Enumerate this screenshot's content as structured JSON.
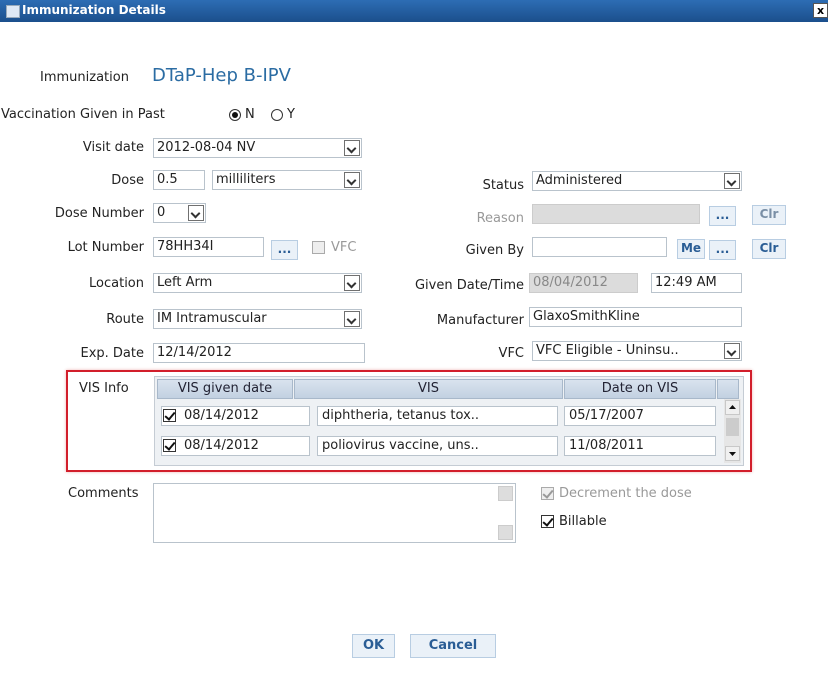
{
  "window": {
    "title": "Immunization Details",
    "close": "x"
  },
  "immunization": {
    "label": "Immunization",
    "name": "DTaP-Hep B-IPV"
  },
  "vaccination_past": {
    "label": "Vaccination Given in Past",
    "opt_n": "N",
    "opt_y": "Y",
    "selected": "N"
  },
  "visit_date": {
    "label": "Visit date",
    "value": "2012-08-04 NV"
  },
  "dose": {
    "label": "Dose",
    "value": "0.5",
    "unit": "milliliters"
  },
  "status": {
    "label": "Status",
    "value": "Administered"
  },
  "dose_number": {
    "label": "Dose Number",
    "value": "0"
  },
  "reason": {
    "label": "Reason",
    "value": "",
    "browse": "...",
    "clear": "Clr"
  },
  "lot_number": {
    "label": "Lot Number",
    "value": "78HH34I",
    "browse": "...",
    "vfc_label": "VFC"
  },
  "given_by": {
    "label": "Given By",
    "value": "",
    "me": "Me",
    "browse": "...",
    "clear": "Clr"
  },
  "location": {
    "label": "Location",
    "value": "Left Arm"
  },
  "given_datetime": {
    "label": "Given Date/Time",
    "date": "08/04/2012",
    "time": "12:49 AM"
  },
  "route": {
    "label": "Route",
    "value": "IM Intramuscular"
  },
  "manufacturer": {
    "label": "Manufacturer",
    "value": "GlaxoSmithKline"
  },
  "exp_date": {
    "label": "Exp. Date",
    "value": "12/14/2012"
  },
  "vfc": {
    "label": "VFC",
    "value": "VFC Eligible - Uninsu.."
  },
  "vis": {
    "label": "VIS Info",
    "columns": [
      "VIS given date",
      "VIS",
      "Date on VIS"
    ],
    "rows": [
      {
        "checked": true,
        "given_date": "08/14/2012",
        "vis": "diphtheria, tetanus tox..",
        "date_on_vis": "05/17/2007"
      },
      {
        "checked": true,
        "given_date": "08/14/2012",
        "vis": "poliovirus vaccine, uns..",
        "date_on_vis": "11/08/2011"
      }
    ]
  },
  "comments": {
    "label": "Comments",
    "value": ""
  },
  "decrement": {
    "label": "Decrement the dose",
    "checked": true,
    "disabled": true
  },
  "billable": {
    "label": "Billable",
    "checked": true
  },
  "buttons": {
    "ok": "OK",
    "cancel": "Cancel"
  }
}
